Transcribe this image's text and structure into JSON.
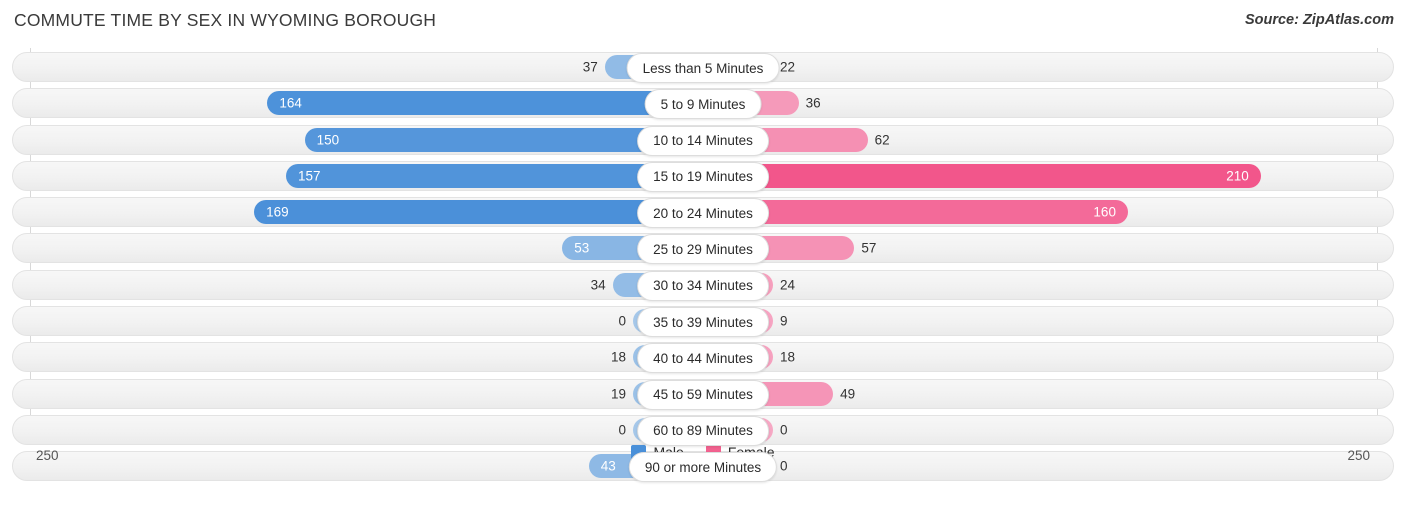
{
  "header": {
    "title": "COMMUTE TIME BY SEX IN WYOMING BOROUGH",
    "source": "Source: ZipAtlas.com"
  },
  "legend": {
    "male_label": "Male",
    "female_label": "Female",
    "male_color": "#4a90d9",
    "female_color": "#f2628f"
  },
  "axis": {
    "left_max": "250",
    "right_max": "250"
  },
  "chart_data": {
    "type": "bar",
    "orientation": "horizontal-diverging",
    "title": "COMMUTE TIME BY SEX IN WYOMING BOROUGH",
    "xlabel": "",
    "ylabel": "",
    "axis_max": 250,
    "grid": true,
    "legend_position": "bottom-center",
    "categories": [
      "Less than 5 Minutes",
      "5 to 9 Minutes",
      "10 to 14 Minutes",
      "15 to 19 Minutes",
      "20 to 24 Minutes",
      "25 to 29 Minutes",
      "30 to 34 Minutes",
      "35 to 39 Minutes",
      "40 to 44 Minutes",
      "45 to 59 Minutes",
      "60 to 89 Minutes",
      "90 or more Minutes"
    ],
    "series": [
      {
        "name": "Male",
        "color": "#4a90d9",
        "values": [
          37,
          164,
          150,
          157,
          169,
          53,
          34,
          0,
          18,
          19,
          0,
          43
        ]
      },
      {
        "name": "Female",
        "color": "#f2628f",
        "values": [
          22,
          36,
          62,
          210,
          160,
          57,
          24,
          9,
          18,
          49,
          0,
          0
        ]
      }
    ]
  }
}
